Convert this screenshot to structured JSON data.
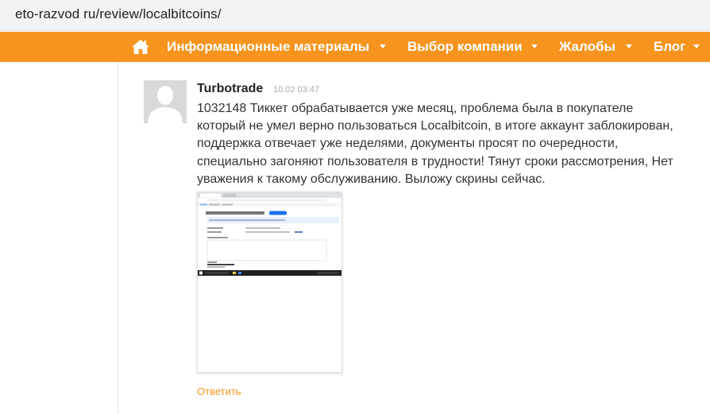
{
  "browser": {
    "url": "eto-razvod ru/review/localbitcoins/"
  },
  "nav": {
    "items": [
      {
        "label": "Информационные материалы"
      },
      {
        "label": "Выбор компании"
      },
      {
        "label": "Жалобы"
      },
      {
        "label": "Блог"
      }
    ],
    "icons": {
      "home": "home-icon",
      "dropdown": "caret-down-icon"
    },
    "colors": {
      "background": "#f7941d",
      "text": "#ffffff"
    }
  },
  "review": {
    "author": "Turbotrade",
    "time": "10.02 03:47",
    "text_lines": [
      "1032148 Тиккет обрабатывается уже месяц, проблема была в покупателе",
      "который не умел верно пользоваться Localbitcoin, в итоге аккаунт заблокирован,",
      "поддержка отвечает уже неделями, документы просят по очередности,",
      "специально загоняют пользователя в трудности! Тянут сроки рассмотрения, Нет",
      "уважения к такому обслуживанию. Выложу скрины сейчас."
    ],
    "reply_label": "Ответить",
    "avatar_icon": "default-user-avatar-icon",
    "attachment": "screenshot-thumbnail"
  },
  "colors": {
    "accent": "#f7941d",
    "author": "#222222",
    "time": "#a8a8a8",
    "body": "#333333"
  }
}
